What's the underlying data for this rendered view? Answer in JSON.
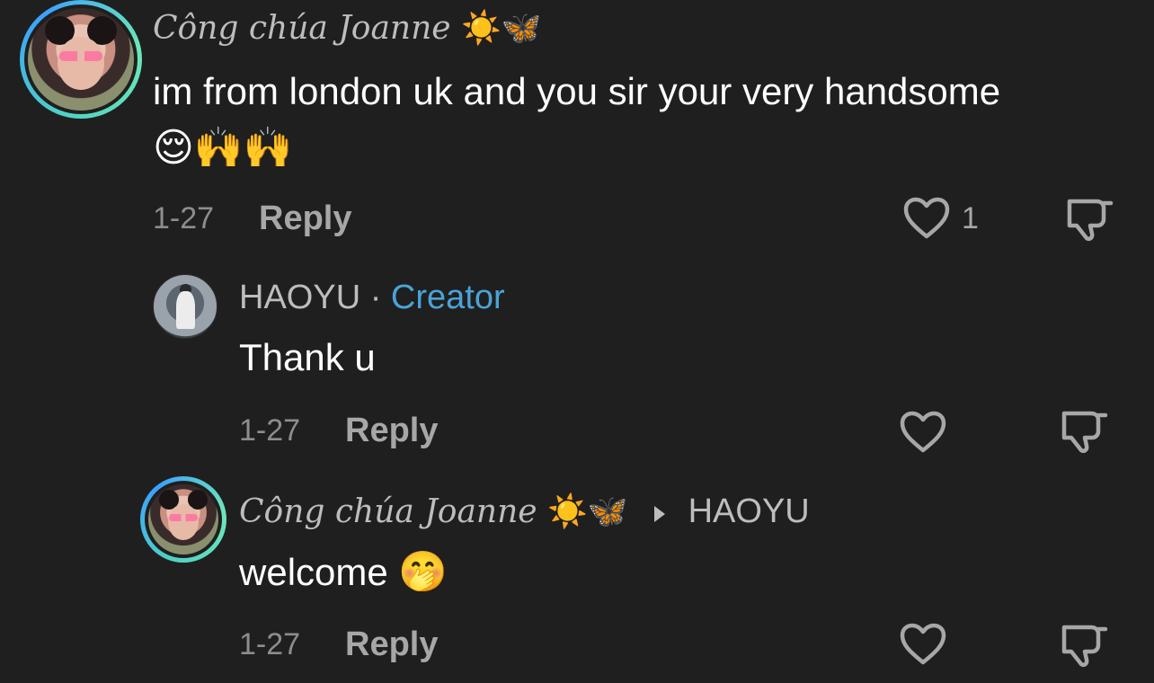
{
  "comments": [
    {
      "author": "Công chúa Joanne",
      "author_emojis": "☀️🦋",
      "text": "im from london uk and you sir your very handsome",
      "text_emojis": "😌🙌🙌",
      "date": "1-27",
      "reply_label": "Reply",
      "like_count": "1"
    },
    {
      "author": "HAOYU",
      "separator": "·",
      "badge": "Creator",
      "text": "Thank u",
      "date": "1-27",
      "reply_label": "Reply"
    },
    {
      "author": "Công chúa Joanne",
      "author_emojis": "☀️🦋",
      "reply_to": "HAOYU",
      "text": "welcome",
      "text_emojis": "🤭",
      "date": "1-27",
      "reply_label": "Reply"
    }
  ],
  "icons": {
    "like": "heart-outline-icon",
    "dislike": "thumbs-down-icon",
    "reply_to": "triangle-right-icon"
  },
  "colors": {
    "background": "#1f1f1f",
    "creator_badge": "#4aa3d8",
    "avatar_ring": "#4fd1c5"
  }
}
